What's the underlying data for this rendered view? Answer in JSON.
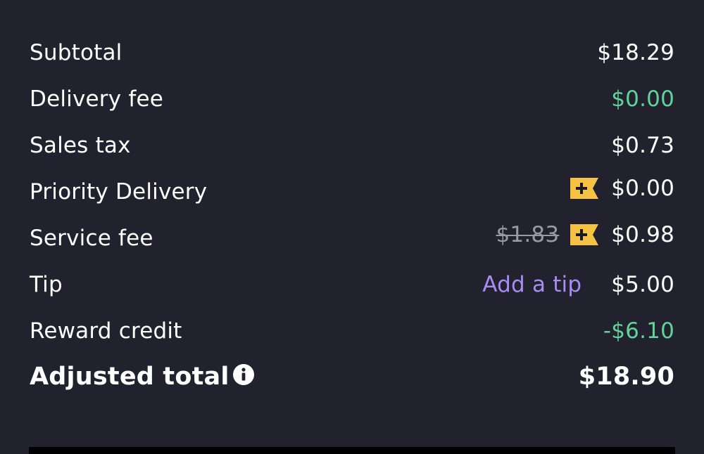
{
  "rows": [
    {
      "label": "Subtotal",
      "value": "$18.29"
    },
    {
      "label": "Delivery fee",
      "value": "$0.00"
    },
    {
      "label": "Sales tax",
      "value": "$0.73"
    },
    {
      "label": "Priority Delivery",
      "value": "$0.00"
    },
    {
      "label": "Service fee",
      "original_value": "$1.83",
      "value": "$0.98"
    },
    {
      "label": "Tip",
      "action": "Add a tip",
      "value": "$5.00"
    },
    {
      "label": "Reward credit",
      "value": "-$6.10"
    }
  ],
  "total": {
    "label": "Adjusted total",
    "value": "$18.90"
  },
  "icons": {
    "plus_badge": "plus-membership-badge-icon",
    "info": "info-icon"
  },
  "colors": {
    "background": "#22222e",
    "text": "#ffffff",
    "savings_green": "#5fd39a",
    "link_purple": "#a98bf2",
    "badge_yellow": "#f5c243",
    "strike_gray": "#9a9aa6"
  }
}
